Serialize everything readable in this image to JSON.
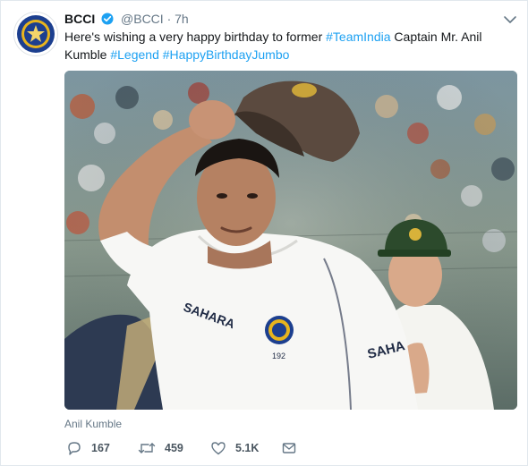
{
  "tweet": {
    "account_name": "BCCI",
    "handle": "@BCCI",
    "separator": "·",
    "time": "7h",
    "text_parts": {
      "p1": "Here's wishing a very happy birthday to former ",
      "tag1": "#TeamIndia",
      "p2": " Captain Mr. Anil Kumble ",
      "tag2": "#Legend",
      "p3": " ",
      "tag3": "#HappyBirthdayJumbo"
    },
    "media_caption": "Anil Kumble",
    "jersey_text": {
      "brand_front": "SAHARA",
      "number": "192",
      "brand_side": "SAHA"
    }
  },
  "actions": {
    "reply_count": "167",
    "retweet_count": "459",
    "like_count": "5.1K"
  },
  "icons": {
    "avatar": "bcci-logo",
    "verified": "verified-badge-icon",
    "menu": "chevron-down-icon",
    "reply": "reply-icon",
    "retweet": "retweet-icon",
    "like": "heart-icon",
    "message": "direct-message-icon"
  },
  "colors": {
    "link": "#1da1f2",
    "text": "#14171a",
    "muted": "#657786",
    "verified": "#1da1f2"
  }
}
